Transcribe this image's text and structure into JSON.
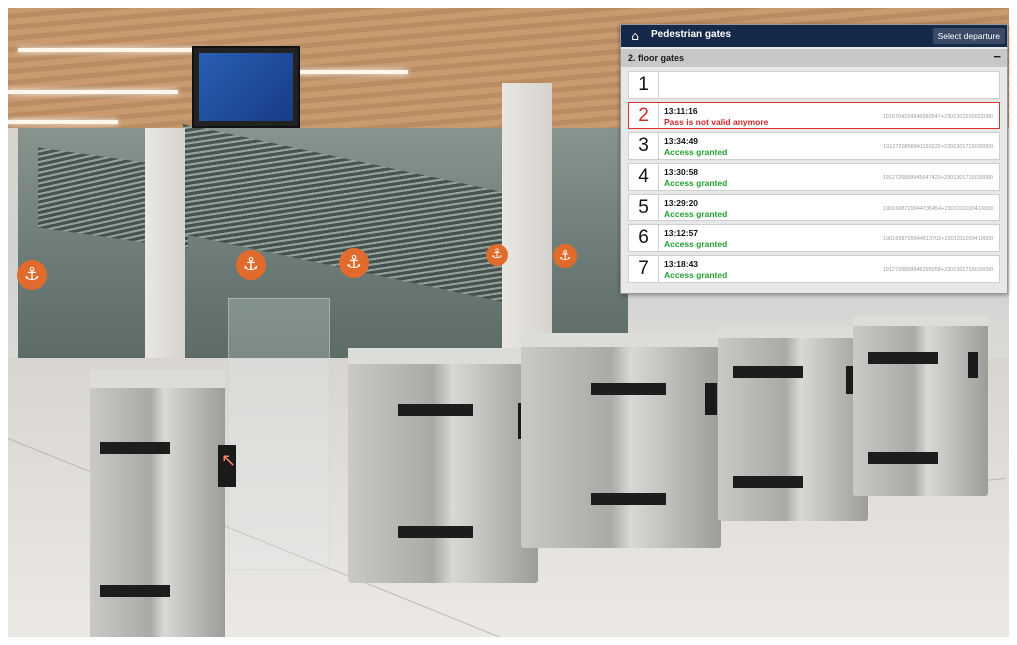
{
  "header": {
    "title": "Pedestrian gates",
    "select_label": "Select departure",
    "home_icon": "home-icon"
  },
  "section": {
    "title": "2. floor gates",
    "collapse_symbol": "−"
  },
  "gates": [
    {
      "number": "1",
      "time": "",
      "status": "",
      "code": "",
      "state": "empty"
    },
    {
      "number": "2",
      "time": "13:11:16",
      "status": "Pass is not valid anymore",
      "code": "1915704224945680547+2301301530022090",
      "state": "error"
    },
    {
      "number": "3",
      "time": "13:34:49",
      "status": "Access granted",
      "code": "1912720858941193232+2301301715030050",
      "state": "ok"
    },
    {
      "number": "4",
      "time": "13:30:58",
      "status": "Access granted",
      "code": "1912720858945647423+2301301715030090",
      "state": "ok"
    },
    {
      "number": "5",
      "time": "13:29:20",
      "status": "Access granted",
      "code": "1901698729944735454+2301311030410000",
      "state": "ok"
    },
    {
      "number": "6",
      "time": "13:12:57",
      "status": "Access granted",
      "code": "1901698729944513702+2301311030410000",
      "state": "ok"
    },
    {
      "number": "7",
      "time": "13:18:43",
      "status": "Access granted",
      "code": "1912720858945295058+2301301715030090",
      "state": "ok"
    }
  ],
  "colors": {
    "header_bg": "#17294a",
    "ok": "#23a030",
    "error": "#d0282c",
    "signage": "#e06b2d"
  }
}
